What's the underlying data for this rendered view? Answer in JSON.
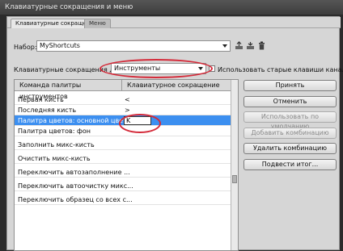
{
  "window": {
    "title": "Клавиатурные сокращения и меню"
  },
  "tabs": [
    {
      "label": "Клавиатурные сокращения"
    },
    {
      "label": "Меню"
    }
  ],
  "set": {
    "label": "Набор:",
    "value": "MyShortcuts"
  },
  "shortcuts_for": {
    "label": "Клавиатурные сокращения для:",
    "value": "Инструменты",
    "legacy_checkbox_label": "Использовать старые клавиши каналов"
  },
  "table": {
    "columns": [
      "Команда палитры инструментов",
      "Клавиатурное сокращение"
    ],
    "rows": [
      {
        "command": "Первая кисть",
        "shortcut": "<"
      },
      {
        "command": "Последняя кисть",
        "shortcut": ">"
      },
      {
        "command": "Палитра цветов: основной цвет",
        "shortcut": "K"
      },
      {
        "command": "Палитра цветов: фон",
        "shortcut": ""
      },
      {
        "command": "Заполнить микс-кисть",
        "shortcut": ""
      },
      {
        "command": "Очистить микс-кисть",
        "shortcut": ""
      },
      {
        "command": "Переключить автозаполнение ...",
        "shortcut": ""
      },
      {
        "command": "Переключить автоочистку микс...",
        "shortcut": ""
      },
      {
        "command": "Переключить образец со всех с...",
        "shortcut": ""
      }
    ]
  },
  "buttons": {
    "accept": "Принять",
    "undo": "Отменить",
    "use_default": "Использовать по умолчанию",
    "add_shortcut": "Добавить комбинацию",
    "delete_shortcut": "Удалить комбинацию",
    "summarize": "Подвести итог..."
  },
  "colors": {
    "selection": "#3c8ff0",
    "callout": "#d42a39"
  }
}
